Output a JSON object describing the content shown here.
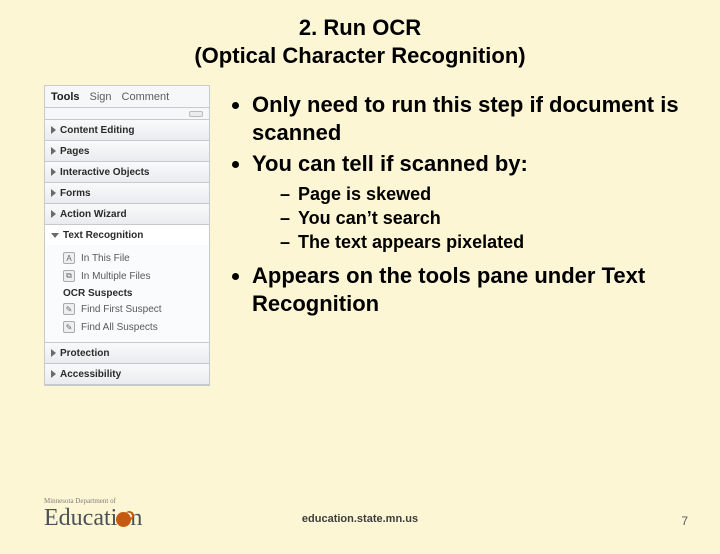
{
  "title_line1": "2. Run OCR",
  "title_line2": "(Optical Character Recognition)",
  "pane": {
    "tabs": {
      "tools": "Tools",
      "sign": "Sign",
      "comment": "Comment"
    },
    "sections": {
      "content_editing": "Content Editing",
      "pages": "Pages",
      "interactive_objects": "Interactive Objects",
      "forms": "Forms",
      "action_wizard": "Action Wizard",
      "text_recognition": "Text Recognition",
      "protection": "Protection",
      "accessibility": "Accessibility"
    },
    "text_recognition": {
      "in_this_file": "In This File",
      "in_multiple_files": "In Multiple Files",
      "suspects_header": "OCR Suspects",
      "find_first": "Find First Suspect",
      "find_all": "Find All Suspects"
    }
  },
  "bullets": {
    "b1": "Only  need to run this step if document is scanned",
    "b2": "You can tell if scanned by:",
    "b2_children": {
      "c1": "Page is skewed",
      "c2": "You can’t search",
      "c3": "The text appears pixelated"
    },
    "b3": "Appears on the tools pane under Text Recognition"
  },
  "footer": {
    "logo_top": "Minnesota Department of",
    "logo_word_pre": "Educati",
    "logo_word_post": "n",
    "url": "education.state.mn.us",
    "page": "7"
  }
}
